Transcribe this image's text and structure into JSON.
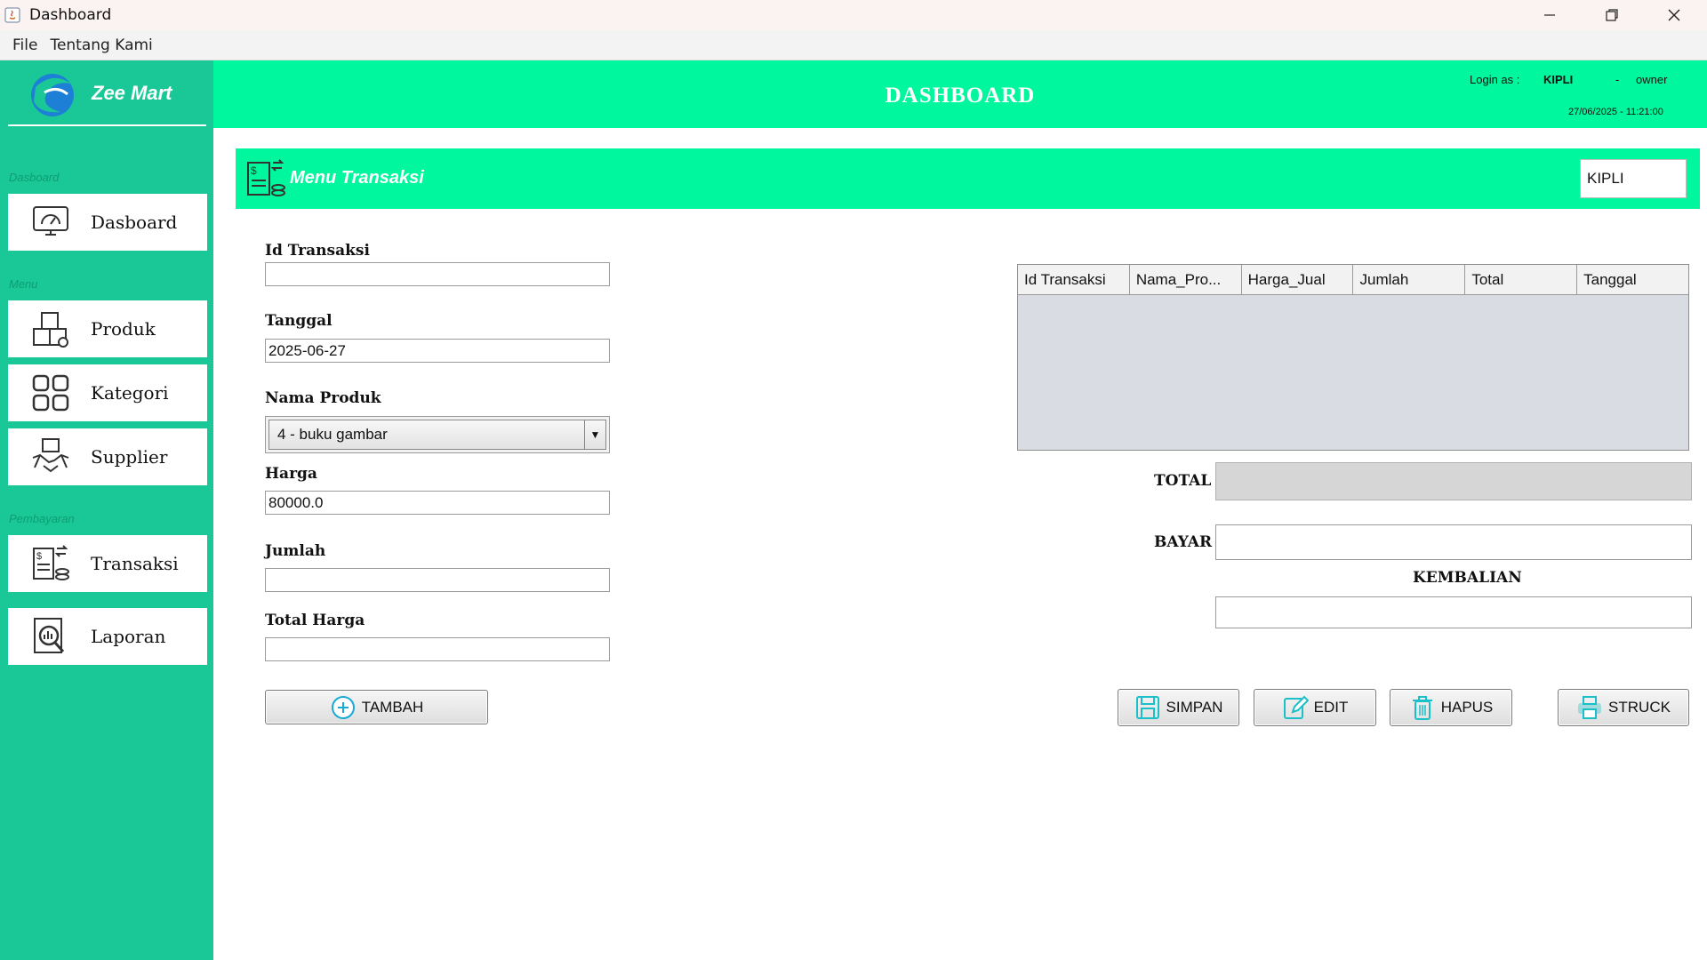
{
  "window": {
    "title": "Dashboard"
  },
  "menubar": {
    "items": [
      "File",
      "Tentang Kami"
    ]
  },
  "brand": {
    "name": "Zee Mart"
  },
  "sidebar": {
    "sections": {
      "dashboard": "Dasboard",
      "menu": "Menu",
      "payment": "Pembayaran"
    },
    "items": [
      {
        "label": "Dasboard",
        "icon": "dashboard-monitor-icon"
      },
      {
        "label": "Produk",
        "icon": "boxes-icon"
      },
      {
        "label": "Kategori",
        "icon": "grid-icon"
      },
      {
        "label": "Supplier",
        "icon": "handshake-icon"
      },
      {
        "label": "Transaksi",
        "icon": "transaction-icon"
      },
      {
        "label": "Laporan",
        "icon": "report-search-icon"
      }
    ]
  },
  "header": {
    "title": "DASHBOARD",
    "login_label": "Login as :",
    "login_user": "KIPLI",
    "login_sep": "-",
    "login_role": "owner",
    "datetime": "27/06/2025 - 11:21:00"
  },
  "panel": {
    "title": "Menu Transaksi",
    "user_value": "KIPLI"
  },
  "form": {
    "id_transaksi": {
      "label": "Id Transaksi",
      "value": ""
    },
    "tanggal": {
      "label": "Tanggal",
      "value": "2025-06-27"
    },
    "nama_produk": {
      "label": "Nama Produk",
      "value": "4 - buku gambar"
    },
    "harga": {
      "label": "Harga",
      "value": "80000.0"
    },
    "jumlah": {
      "label": "Jumlah",
      "value": ""
    },
    "total_harga": {
      "label": "Total Harga",
      "value": ""
    },
    "add_button": "TAMBAH"
  },
  "table": {
    "columns": [
      "Id Transaksi",
      "Nama_Pro...",
      "Harga_Jual",
      "Jumlah",
      "Total",
      "Tanggal"
    ],
    "rows": []
  },
  "payment": {
    "total_label": "TOTAL",
    "bayar_label": "BAYAR",
    "kembalian_label": "KEMBALIAN"
  },
  "actions": {
    "save": "SIMPAN",
    "edit": "EDIT",
    "delete": "HAPUS",
    "receipt": "STRUCK"
  },
  "colors": {
    "sidebar": "#19c896",
    "header": "#00f79e",
    "accent_icon": "#19c0c8"
  }
}
